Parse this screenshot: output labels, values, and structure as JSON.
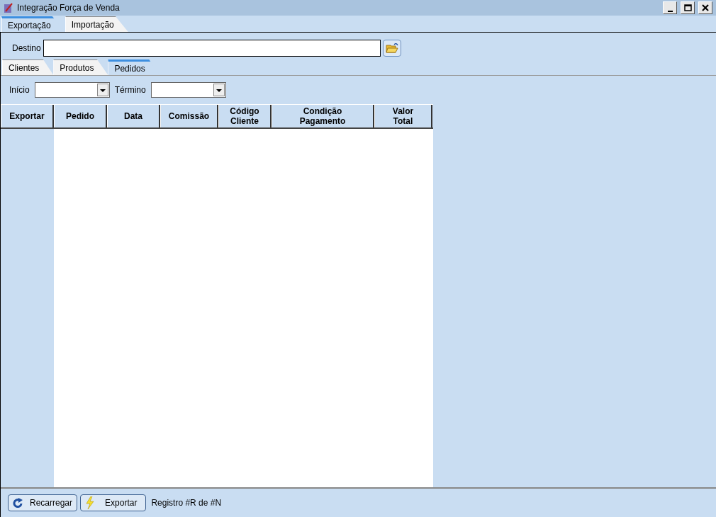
{
  "window": {
    "title": "Integração Força de Venda"
  },
  "tabs": [
    {
      "label": "Exportação",
      "selected": true
    },
    {
      "label": "Importação",
      "selected": false
    }
  ],
  "destino": {
    "label": "Destino"
  },
  "subtabs": [
    {
      "label": "Clientes",
      "selected": false
    },
    {
      "label": "Produtos",
      "selected": false
    },
    {
      "label": "Pedidos",
      "selected": true
    }
  ],
  "filters": [
    {
      "label": "Início"
    },
    {
      "label": "Término"
    }
  ],
  "table": {
    "columns": [
      {
        "label": "Exportar"
      },
      {
        "label": "Pedido"
      },
      {
        "label": "Data"
      },
      {
        "label": "Comissão"
      },
      {
        "label": "Código\nCliente"
      },
      {
        "label": "Condição\nPagamento"
      },
      {
        "label": "Valor\nTotal"
      }
    ]
  },
  "buttons": [
    {
      "label": "Recarregar",
      "kind": "reload"
    },
    {
      "label": "Exportar",
      "kind": "lightning"
    }
  ],
  "status": "Registro #R de #N"
}
